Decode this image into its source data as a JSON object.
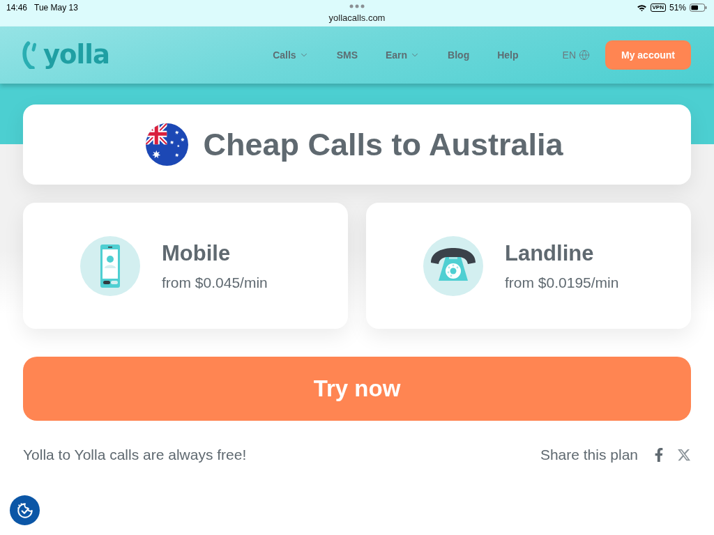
{
  "status_bar": {
    "time": "14:46",
    "date": "Tue May 13",
    "url": "yollacalls.com",
    "vpn": "VPN",
    "battery": "51%"
  },
  "header": {
    "logo": "yolla",
    "nav": [
      {
        "label": "Calls",
        "dropdown": true
      },
      {
        "label": "SMS",
        "dropdown": false
      },
      {
        "label": "Earn",
        "dropdown": true
      },
      {
        "label": "Blog",
        "dropdown": false
      },
      {
        "label": "Help",
        "dropdown": false
      }
    ],
    "language": "EN",
    "account_button": "My account"
  },
  "title_card": {
    "title": "Cheap Calls to Australia"
  },
  "plans": [
    {
      "kind": "mobile",
      "name": "Mobile",
      "price": "from $0.045/min"
    },
    {
      "kind": "landline",
      "name": "Landline",
      "price": "from $0.0195/min"
    }
  ],
  "cta_button": "Try now",
  "footer": {
    "note": "Yolla to Yolla calls are always free!",
    "share_label": "Share this plan"
  }
}
